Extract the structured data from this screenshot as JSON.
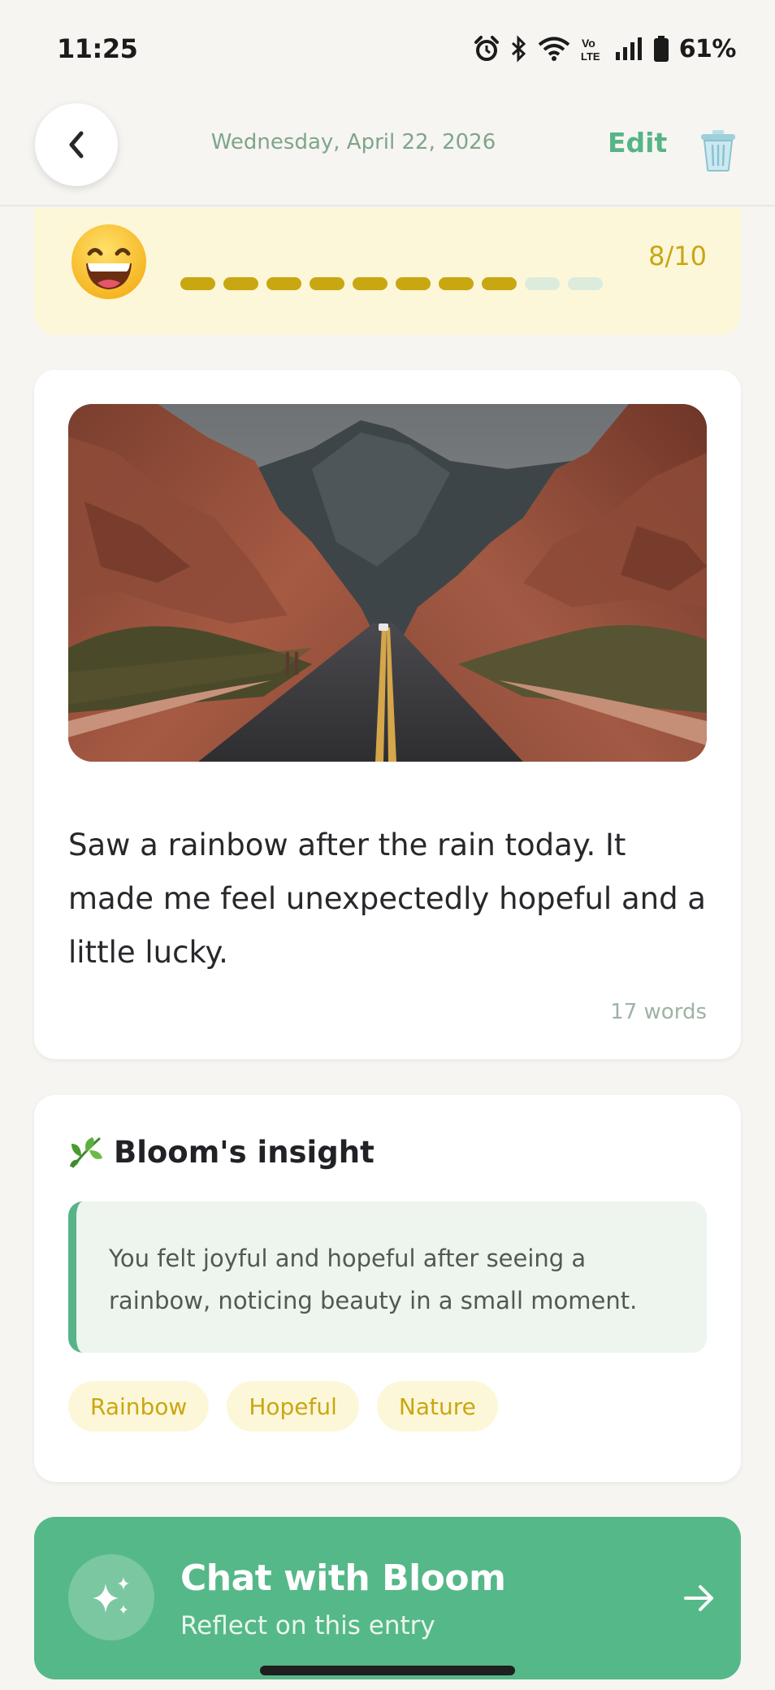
{
  "status_bar": {
    "time": "11:25",
    "battery": "61%",
    "icons": [
      "alarm-icon",
      "bluetooth-icon",
      "wifi-icon",
      "volte-icon",
      "signal-icon",
      "battery-icon"
    ]
  },
  "header": {
    "date": "Wednesday, April 22, 2026",
    "edit_label": "Edit",
    "back_icon": "chevron-left-icon",
    "delete_icon": "trash-icon"
  },
  "mood": {
    "emoji": "grinning-face",
    "score": 8,
    "max": 10,
    "score_label": "8/10",
    "color_active": "#c9a712",
    "color_inactive": "#dcebdc"
  },
  "entry": {
    "photo": "desert-road-canyon-photo",
    "text": "Saw a rainbow after the rain today. It made me feel unexpectedly hopeful and a little lucky.",
    "word_count": "17 words"
  },
  "insight": {
    "icon": "leaf-icon",
    "title": "Bloom's insight",
    "text": "You felt joyful and hopeful after seeing a rainbow, noticing beauty in a small moment.",
    "tags": [
      "Rainbow",
      "Hopeful",
      "Nature"
    ]
  },
  "chat": {
    "title": "Chat with Bloom",
    "subtitle": "Reflect on this entry",
    "icon": "sparkles-icon",
    "arrow_icon": "arrow-right-icon",
    "color": "#55b888"
  },
  "colors": {
    "accent": "#57b488",
    "mood_bg": "#fdf7d9",
    "background": "#f6f5f1"
  }
}
